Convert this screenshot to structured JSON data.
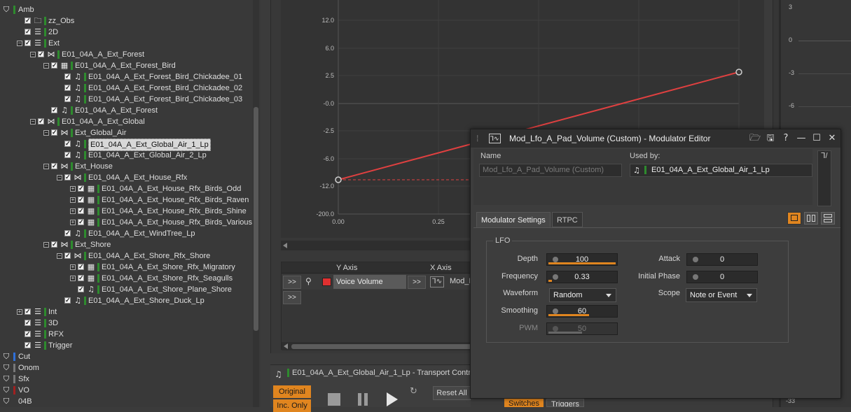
{
  "tree": {
    "items": [
      {
        "label": "Amb",
        "color": "#2e8b2e",
        "icon": "work-unit-icon",
        "checked": false
      },
      {
        "label": "zz_Obs",
        "color": "#2e8b2e",
        "icon": "folder-icon",
        "checked": true
      },
      {
        "label": "2D",
        "color": "#2e8b2e",
        "icon": "blend-container-icon",
        "checked": true
      },
      {
        "label": "Ext",
        "color": "#2e8b2e",
        "icon": "blend-container-icon",
        "checked": true
      },
      {
        "label": "E01_04A_A_Ext_Forest",
        "color": "#2e8b2e",
        "icon": "switch-container-icon",
        "checked": true
      },
      {
        "label": "E01_04A_A_Ext_Forest_Bird",
        "color": "#2e8b2e",
        "icon": "random-container-icon",
        "checked": true
      },
      {
        "label": "E01_04A_A_Ext_Forest_Bird_Chickadee_01",
        "color": "#2e8b2e",
        "icon": "sound-icon",
        "checked": true
      },
      {
        "label": "E01_04A_A_Ext_Forest_Bird_Chickadee_02",
        "color": "#2e8b2e",
        "icon": "sound-icon",
        "checked": true
      },
      {
        "label": "E01_04A_A_Ext_Forest_Bird_Chickadee_03",
        "color": "#2e8b2e",
        "icon": "sound-icon",
        "checked": true
      },
      {
        "label": "E01_04A_A_Ext_Forest",
        "color": "#2e8b2e",
        "icon": "sound-icon",
        "checked": true
      },
      {
        "label": "E01_04A_A_Ext_Global",
        "color": "#2e8b2e",
        "icon": "switch-container-icon",
        "checked": true
      },
      {
        "label": "Ext_Global_Air",
        "color": "#2e8b2e",
        "icon": "switch-container-icon",
        "checked": true
      },
      {
        "label": "E01_04A_A_Ext_Global_Air_1_Lp",
        "color": "#2e8b2e",
        "icon": "sound-icon",
        "checked": true
      },
      {
        "label": "E01_04A_A_Ext_Global_Air_2_Lp",
        "color": "#2e8b2e",
        "icon": "sound-icon",
        "checked": true
      },
      {
        "label": "Ext_House",
        "color": "#2e8b2e",
        "icon": "switch-container-icon",
        "checked": true
      },
      {
        "label": "E01_04A_A_Ext_House_Rfx",
        "color": "#2e8b2e",
        "icon": "switch-container-icon",
        "checked": true
      },
      {
        "label": "E01_04A_A_Ext_House_Rfx_Birds_Odd",
        "color": "#2e8b2e",
        "icon": "random-container-icon",
        "checked": true
      },
      {
        "label": "E01_04A_A_Ext_House_Rfx_Birds_Raven",
        "color": "#2e8b2e",
        "icon": "random-container-icon",
        "checked": true
      },
      {
        "label": "E01_04A_A_Ext_House_Rfx_Birds_Shine",
        "color": "#2e8b2e",
        "icon": "random-container-icon",
        "checked": true
      },
      {
        "label": "E01_04A_A_Ext_House_Rfx_Birds_Various",
        "color": "#2e8b2e",
        "icon": "random-container-icon",
        "checked": true
      },
      {
        "label": "E01_04A_A_Ext_WindTree_Lp",
        "color": "#2e8b2e",
        "icon": "sound-icon",
        "checked": true
      },
      {
        "label": "Ext_Shore",
        "color": "#2e8b2e",
        "icon": "switch-container-icon",
        "checked": true
      },
      {
        "label": "E01_04A_A_Ext_Shore_Rfx_Shore",
        "color": "#2e8b2e",
        "icon": "switch-container-icon",
        "checked": true
      },
      {
        "label": "E01_04A_A_Ext_Shore_Rfx_Migratory",
        "color": "#2e8b2e",
        "icon": "random-container-icon",
        "checked": true
      },
      {
        "label": "E01_04A_A_Ext_Shore_Rfx_Seagulls",
        "color": "#2e8b2e",
        "icon": "random-container-icon",
        "checked": true
      },
      {
        "label": "E01_04A_A_Ext_Shore_Plane_Shore",
        "color": "#2e8b2e",
        "icon": "sound-icon",
        "checked": true
      },
      {
        "label": "E01_04A_A_Ext_Shore_Duck_Lp",
        "color": "#2e8b2e",
        "icon": "sound-icon",
        "checked": true
      },
      {
        "label": "Int",
        "color": "#2e8b2e",
        "icon": "blend-container-icon",
        "checked": true
      },
      {
        "label": "3D",
        "color": "#2e8b2e",
        "icon": "blend-container-icon",
        "checked": true
      },
      {
        "label": "RFX",
        "color": "#2e8b2e",
        "icon": "blend-container-icon",
        "checked": true
      },
      {
        "label": "Trigger",
        "color": "#2e8b2e",
        "icon": "blend-container-icon",
        "checked": true
      },
      {
        "label": "Cut",
        "color": "#2f6fd8",
        "icon": "work-unit-icon",
        "checked": false
      },
      {
        "label": "Onom",
        "color": "#777777",
        "icon": "work-unit-icon",
        "checked": false
      },
      {
        "label": "Sfx",
        "color": "#777777",
        "icon": "work-unit-icon",
        "checked": false
      },
      {
        "label": "VO",
        "color": "#a02020",
        "icon": "work-unit-icon",
        "checked": false
      },
      {
        "label": "04B",
        "color": "",
        "icon": "work-unit-icon",
        "checked": false
      }
    ]
  },
  "graph": {
    "y_ticks": [
      "12.0",
      "6.0",
      "2.5",
      "-0.0",
      "-2.5",
      "-6.0",
      "-12.0",
      "-200.0"
    ],
    "x_ticks": [
      "0.00",
      "0.25"
    ],
    "curve_color": "#e04040",
    "axis_table": {
      "y_axis_header": "Y Axis",
      "x_axis_header": "X Axis",
      "row_button": ">>",
      "property": "Voice Volume",
      "property_color": "#e03030",
      "x_button": ">>",
      "x_value": "Mod_L",
      "add_button": ">>"
    }
  },
  "right_strip": {
    "ticks": [
      "3",
      "0",
      "-3",
      "-6",
      "-33"
    ]
  },
  "transport": {
    "title": "E01_04A_A_Ext_Global_Air_1_Lp - Transport Contro",
    "original_label": "Original",
    "inc_only_label": "Inc. Only",
    "reset_all_label": "Reset All",
    "switches_label": "Switches",
    "triggers_label": "Triggers"
  },
  "modulator": {
    "title": "Mod_Lfo_A_Pad_Volume (Custom) - Modulator Editor",
    "name_label": "Name",
    "name_value": "Mod_Lfo_A_Pad_Volume (Custom)",
    "used_by_label": "Used by:",
    "used_by_value": "E01_04A_A_Ext_Global_Air_1_Lp",
    "tabs": [
      "Modulator Settings",
      "RTPC"
    ],
    "group_label": "LFO",
    "depth_label": "Depth",
    "depth_value": "100",
    "depth_fill": 1.0,
    "frequency_label": "Frequency",
    "frequency_value": "0.33",
    "frequency_fill": 0.05,
    "waveform_label": "Waveform",
    "waveform_value": "Random",
    "smoothing_label": "Smoothing",
    "smoothing_value": "60",
    "smoothing_fill": 0.6,
    "pwm_label": "PWM",
    "pwm_value": "50",
    "pwm_fill": 0.5,
    "attack_label": "Attack",
    "attack_value": "0",
    "initial_phase_label": "Initial Phase",
    "initial_phase_value": "0",
    "scope_label": "Scope",
    "scope_value": "Note or Event",
    "accent_color": "#e0851f"
  }
}
